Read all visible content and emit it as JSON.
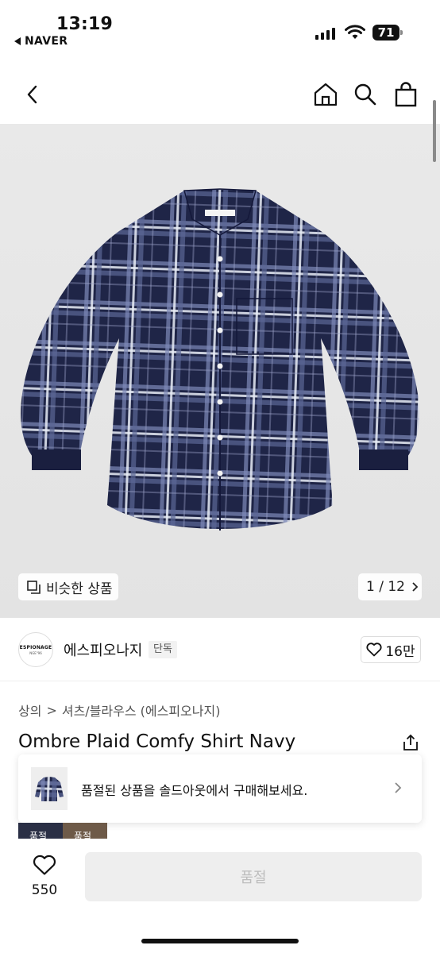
{
  "status_bar": {
    "time": "13:19",
    "back_app": "NAVER",
    "battery": "71"
  },
  "nav": {
    "icons": [
      "back-icon",
      "home-icon",
      "search-icon",
      "shopping-bag-icon"
    ]
  },
  "gallery": {
    "similar_label": "비슷한 상품",
    "page_indicator": "1 / 12"
  },
  "brand": {
    "logo_line1": "ESPIONAGE",
    "logo_line2": "NGE\"96",
    "name": "에스피오나지",
    "badge": "단독",
    "likes": "16만"
  },
  "breadcrumb": {
    "level1": "상의",
    "separator": ">",
    "level2": "셔츠/블라우스 (에스피오나지)"
  },
  "product": {
    "title": "Ombre Plaid Comfy Shirt Navy"
  },
  "soldout_banner": {
    "text": "품절된 상품을 솔드아웃에서 구매해보세요."
  },
  "thumbs": {
    "labels": [
      "품절",
      "품절"
    ]
  },
  "bottom": {
    "wish_count": "550",
    "buy_label": "품절"
  },
  "colors": {
    "accent": "#111111",
    "disabled_button": "#eeeeee",
    "disabled_text": "#bdbdbd",
    "shirt_navy": "#1f2547"
  }
}
